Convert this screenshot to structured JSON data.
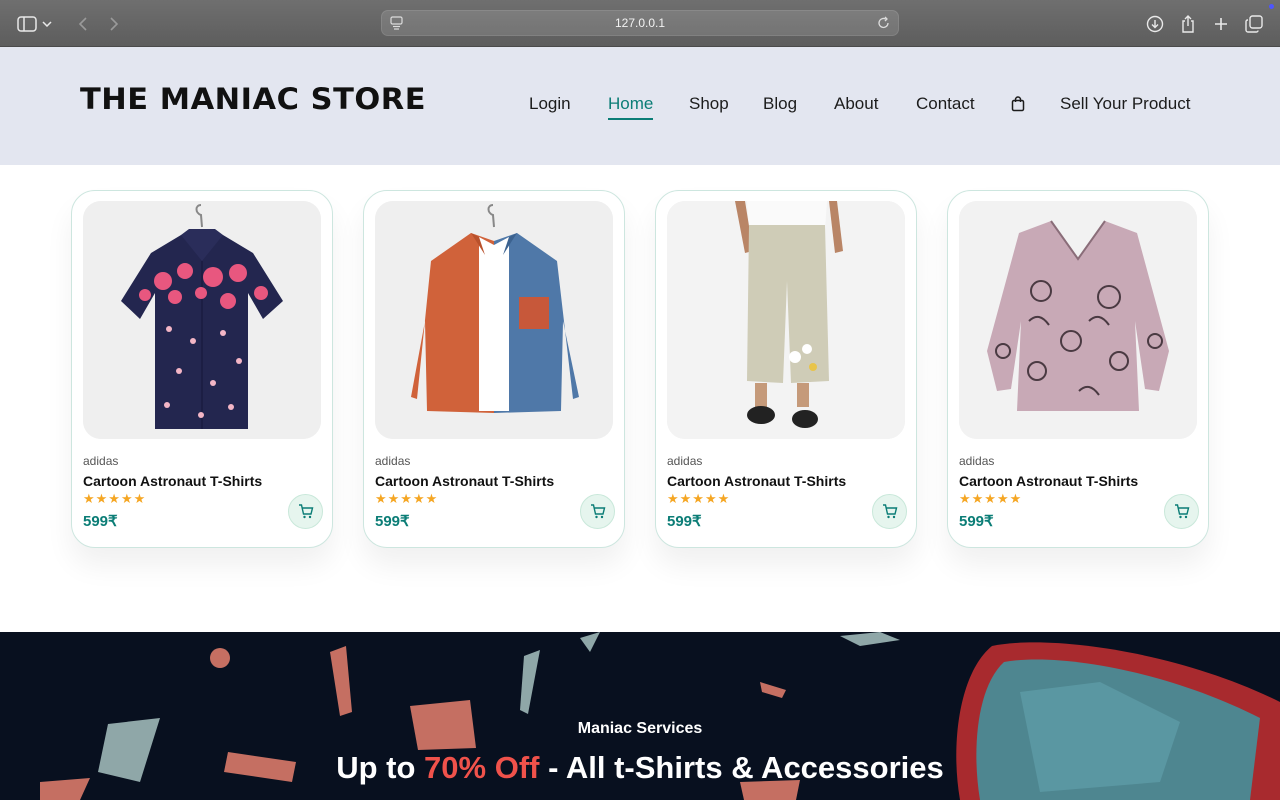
{
  "browser": {
    "url": "127.0.0.1",
    "icons": [
      "sidebar-icon",
      "chevron-down-icon",
      "back-icon",
      "forward-icon",
      "site-settings-icon",
      "reload-icon",
      "download-icon",
      "share-icon",
      "new-tab-icon",
      "tabs-overview-icon"
    ]
  },
  "header": {
    "logo": "THE MANIAC STORE",
    "nav": [
      {
        "label": "Login"
      },
      {
        "label": "Home"
      },
      {
        "label": "Shop"
      },
      {
        "label": "Blog"
      },
      {
        "label": "About"
      },
      {
        "label": "Contact"
      },
      {
        "label": "Sell Your Product"
      }
    ],
    "active_nav": "Home",
    "accent_color": "#0b7d76"
  },
  "products": [
    {
      "brand": "adidas",
      "name": "Cartoon Astronaut T-Shirts",
      "rating": 5,
      "price": "599₹",
      "stars": "★★★★★",
      "image": "floral-navy-shirt"
    },
    {
      "brand": "adidas",
      "name": "Cartoon Astronaut T-Shirts",
      "rating": 5,
      "price": "599₹",
      "stars": "★★★★★",
      "image": "orange-blue-overshirt"
    },
    {
      "brand": "adidas",
      "name": "Cartoon Astronaut T-Shirts",
      "rating": 5,
      "price": "599₹",
      "stars": "★★★★★",
      "image": "beige-linen-pants"
    },
    {
      "brand": "adidas",
      "name": "Cartoon Astronaut T-Shirts",
      "rating": 5,
      "price": "599₹",
      "stars": "★★★★★",
      "image": "lilac-cat-print-blouse"
    }
  ],
  "banner": {
    "kicker": "Maniac Services",
    "headline_pre": "Up to ",
    "headline_highlight": "70% Off",
    "headline_post": " - All t-Shirts & Accessories",
    "highlight_color": "#f0524b",
    "background_color": "#08101f"
  }
}
